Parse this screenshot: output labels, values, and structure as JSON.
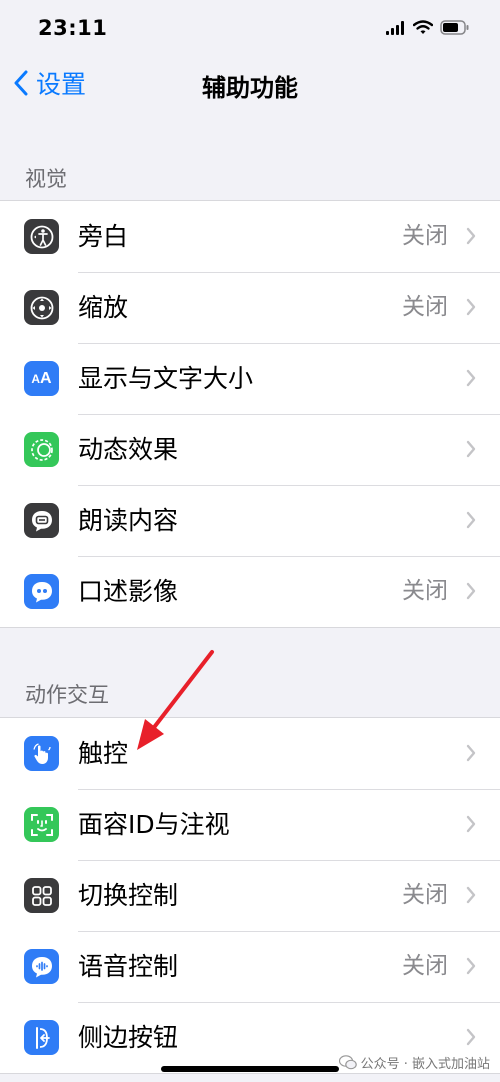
{
  "status": {
    "time": "23:11"
  },
  "nav": {
    "back_label": "设置",
    "title": "辅助功能"
  },
  "sections": [
    {
      "header": "视觉",
      "items": [
        {
          "label": "旁白",
          "value": "关闭",
          "icon": "voiceover-icon",
          "icon_color": "#3a3a3c"
        },
        {
          "label": "缩放",
          "value": "关闭",
          "icon": "zoom-icon",
          "icon_color": "#3a3a3c"
        },
        {
          "label": "显示与文字大小",
          "value": "",
          "icon": "text-size-icon",
          "icon_color": "#2f7cf6"
        },
        {
          "label": "动态效果",
          "value": "",
          "icon": "motion-icon",
          "icon_color": "#34c759"
        },
        {
          "label": "朗读内容",
          "value": "",
          "icon": "spoken-content-icon",
          "icon_color": "#3a3a3c"
        },
        {
          "label": "口述影像",
          "value": "关闭",
          "icon": "audio-description-icon",
          "icon_color": "#2f7cf6"
        }
      ]
    },
    {
      "header": "动作交互",
      "items": [
        {
          "label": "触控",
          "value": "",
          "icon": "touch-icon",
          "icon_color": "#2f7cf6"
        },
        {
          "label": "面容ID与注视",
          "value": "",
          "icon": "face-id-icon",
          "icon_color": "#34c759"
        },
        {
          "label": "切换控制",
          "value": "关闭",
          "icon": "switch-control-icon",
          "icon_color": "#3a3a3c"
        },
        {
          "label": "语音控制",
          "value": "关闭",
          "icon": "voice-control-icon",
          "icon_color": "#2f7cf6"
        },
        {
          "label": "侧边按钮",
          "value": "",
          "icon": "side-button-icon",
          "icon_color": "#2f7cf6"
        }
      ]
    }
  ],
  "watermark": {
    "text": "公众号 · 嵌入式加油站"
  }
}
